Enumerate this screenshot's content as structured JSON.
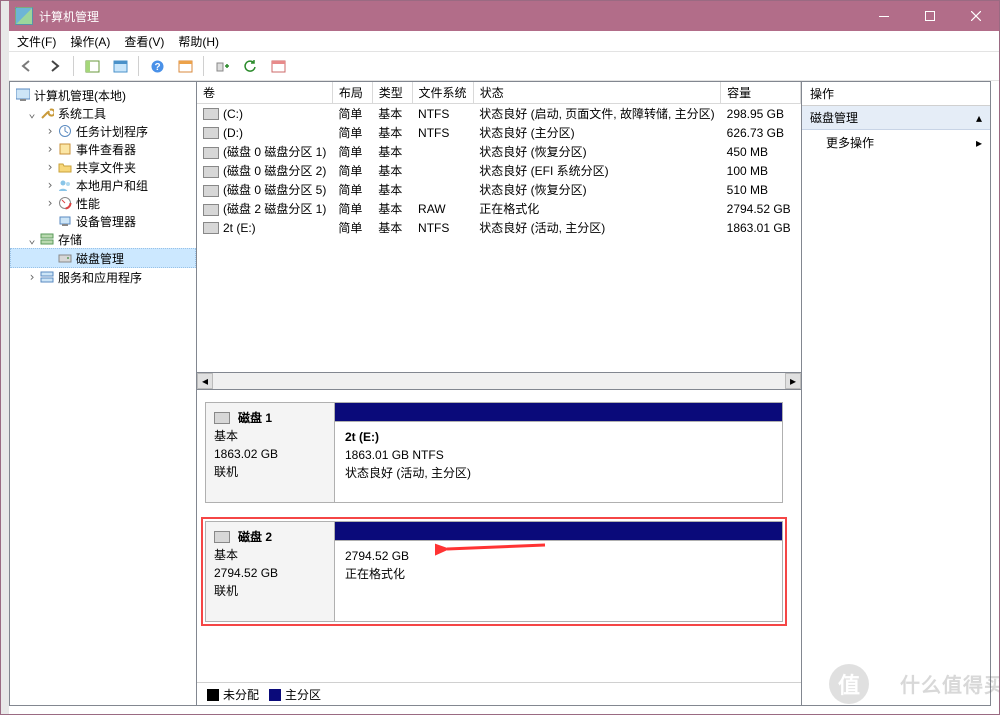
{
  "window": {
    "title": "计算机管理"
  },
  "menu": {
    "file": "文件(F)",
    "action": "操作(A)",
    "view": "查看(V)",
    "help": "帮助(H)"
  },
  "tree": {
    "root": "计算机管理(本地)",
    "system_tools": "系统工具",
    "task_scheduler": "任务计划程序",
    "event_viewer": "事件查看器",
    "shared": "共享文件夹",
    "users": "本地用户和组",
    "perf": "性能",
    "devmgr": "设备管理器",
    "storage": "存储",
    "diskmgmt": "磁盘管理",
    "services": "服务和应用程序"
  },
  "cols": {
    "vol": "卷",
    "layout": "布局",
    "type": "类型",
    "fs": "文件系统",
    "status": "状态",
    "capacity": "容量"
  },
  "vols": [
    {
      "name": "(C:)",
      "layout": "简单",
      "type": "基本",
      "fs": "NTFS",
      "status": "状态良好 (启动, 页面文件, 故障转储, 主分区)",
      "cap": "298.95 GB"
    },
    {
      "name": "(D:)",
      "layout": "简单",
      "type": "基本",
      "fs": "NTFS",
      "status": "状态良好 (主分区)",
      "cap": "626.73 GB"
    },
    {
      "name": "(磁盘 0 磁盘分区 1)",
      "layout": "简单",
      "type": "基本",
      "fs": "",
      "status": "状态良好 (恢复分区)",
      "cap": "450 MB"
    },
    {
      "name": "(磁盘 0 磁盘分区 2)",
      "layout": "简单",
      "type": "基本",
      "fs": "",
      "status": "状态良好 (EFI 系统分区)",
      "cap": "100 MB"
    },
    {
      "name": "(磁盘 0 磁盘分区 5)",
      "layout": "简单",
      "type": "基本",
      "fs": "",
      "status": "状态良好 (恢复分区)",
      "cap": "510 MB"
    },
    {
      "name": "(磁盘 2 磁盘分区 1)",
      "layout": "简单",
      "type": "基本",
      "fs": "RAW",
      "status": "正在格式化",
      "cap": "2794.52 GB"
    },
    {
      "name": "2t (E:)",
      "layout": "简单",
      "type": "基本",
      "fs": "NTFS",
      "status": "状态良好 (活动, 主分区)",
      "cap": "1863.01 GB"
    }
  ],
  "disk1": {
    "title": "磁盘 1",
    "type": "基本",
    "cap": "1863.02 GB",
    "state": "联机",
    "part_name": "2t  (E:)",
    "part_line2": "1863.01 GB NTFS",
    "part_line3": "状态良好 (活动, 主分区)"
  },
  "disk2": {
    "title": "磁盘 2",
    "type": "基本",
    "cap": "2794.52 GB",
    "state": "联机",
    "part_line1": "2794.52 GB",
    "part_line2": "正在格式化"
  },
  "legend": {
    "unalloc": "未分配",
    "primary": "主分区"
  },
  "actions": {
    "header": "操作",
    "section": "磁盘管理",
    "more": "更多操作"
  },
  "watermark": "什么值得买"
}
